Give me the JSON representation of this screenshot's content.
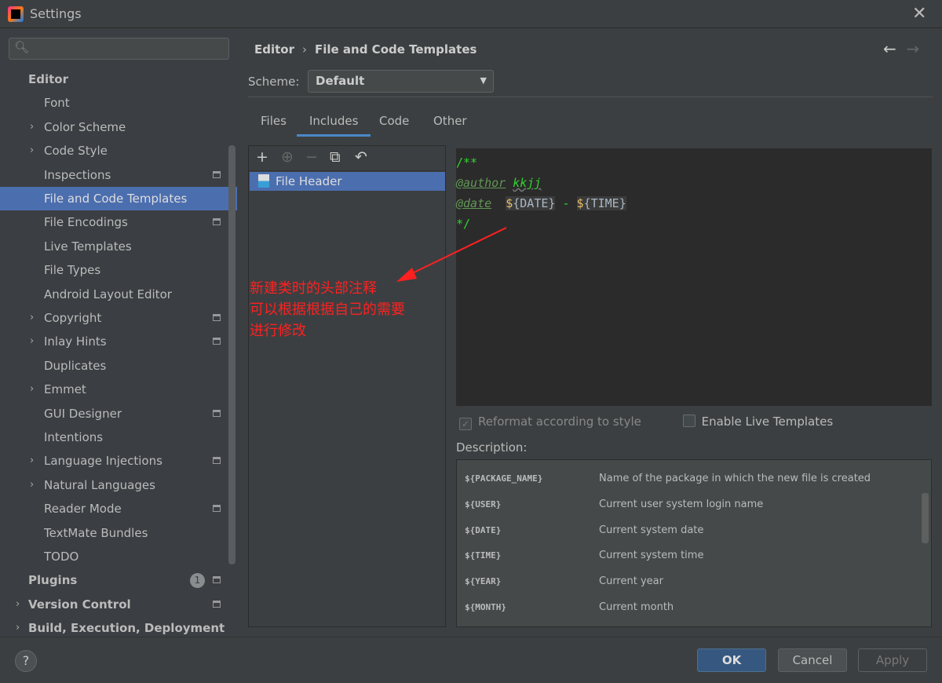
{
  "window": {
    "title": "Settings",
    "close": "✕"
  },
  "search": {
    "icon": "🔍︎",
    "placeholder": ""
  },
  "sidebar": {
    "items": [
      {
        "label": "Editor",
        "level": 0,
        "bold": true
      },
      {
        "label": "Font",
        "level": 1
      },
      {
        "label": "Color Scheme",
        "level": 1,
        "expand": true
      },
      {
        "label": "Code Style",
        "level": 1,
        "expand": true
      },
      {
        "label": "Inspections",
        "level": 1,
        "icon": true
      },
      {
        "label": "File and Code Templates",
        "level": 1,
        "selected": true
      },
      {
        "label": "File Encodings",
        "level": 1,
        "icon": true
      },
      {
        "label": "Live Templates",
        "level": 1
      },
      {
        "label": "File Types",
        "level": 1
      },
      {
        "label": "Android Layout Editor",
        "level": 1
      },
      {
        "label": "Copyright",
        "level": 1,
        "expand": true,
        "icon": true
      },
      {
        "label": "Inlay Hints",
        "level": 1,
        "expand": true,
        "icon": true
      },
      {
        "label": "Duplicates",
        "level": 1
      },
      {
        "label": "Emmet",
        "level": 1,
        "expand": true
      },
      {
        "label": "GUI Designer",
        "level": 1,
        "icon": true
      },
      {
        "label": "Intentions",
        "level": 1
      },
      {
        "label": "Language Injections",
        "level": 1,
        "expand": true,
        "icon": true
      },
      {
        "label": "Natural Languages",
        "level": 1,
        "expand": true
      },
      {
        "label": "Reader Mode",
        "level": 1,
        "icon": true
      },
      {
        "label": "TextMate Bundles",
        "level": 1
      },
      {
        "label": "TODO",
        "level": 1
      },
      {
        "label": "Plugins",
        "level": 0,
        "bold": true,
        "badge": "1",
        "icon": true
      },
      {
        "label": "Version Control",
        "level": 0,
        "bold": true,
        "expand": true,
        "icon": true
      },
      {
        "label": "Build, Execution, Deployment",
        "level": 0,
        "bold": true,
        "expand": true
      }
    ]
  },
  "breadcrumb": {
    "parent": "Editor",
    "separator": "›",
    "current": "File and Code Templates",
    "back": "←",
    "forward": "→"
  },
  "scheme": {
    "label": "Scheme:",
    "value": "Default"
  },
  "tabs": [
    {
      "label": "Files"
    },
    {
      "label": "Includes",
      "active": true
    },
    {
      "label": "Code"
    },
    {
      "label": "Other"
    }
  ],
  "toolbar": {
    "add": "+",
    "add_child": "⊕",
    "remove": "−",
    "copy": "⧉",
    "reset": "↶"
  },
  "templates": [
    {
      "label": "File Header",
      "selected": true
    }
  ],
  "editor": {
    "line1": "/**",
    "author_tag": "@author",
    "author": "kkjj",
    "date_tag": "@date",
    "dollar1": "$",
    "date_var": "{DATE}",
    "dash": " - ",
    "dollar2": "$",
    "time_var": "{TIME}",
    "line4": "*/"
  },
  "options": {
    "reformat": "Reformat according to style",
    "reformat_checked": true,
    "reformat_disabled": true,
    "live": "Enable Live Templates",
    "live_checked": false
  },
  "description": {
    "label": "Description:",
    "rows": [
      {
        "var": "${PACKAGE_NAME}",
        "text": "Name of the package in which the new file is created"
      },
      {
        "var": "${USER}",
        "text": "Current user system login name"
      },
      {
        "var": "${DATE}",
        "text": "Current system date"
      },
      {
        "var": "${TIME}",
        "text": "Current system time"
      },
      {
        "var": "${YEAR}",
        "text": "Current year"
      },
      {
        "var": "${MONTH}",
        "text": "Current month"
      }
    ]
  },
  "annotation": {
    "line1": "新建类时的头部注释",
    "line2": "可以根据根据自己的需要",
    "line3": "进行修改",
    "color": "#ff2020"
  },
  "buttons": {
    "help": "?",
    "ok": "OK",
    "cancel": "Cancel",
    "apply": "Apply"
  }
}
